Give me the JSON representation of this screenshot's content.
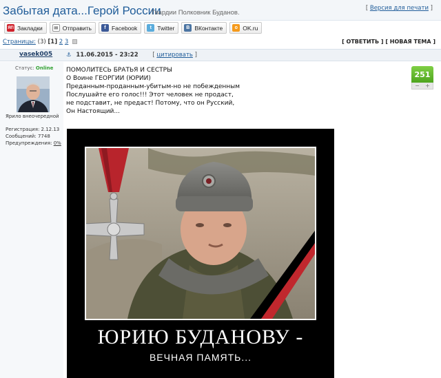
{
  "header": {
    "title": "Забытая дата...Герой России",
    "subtitle": "Гвардии Полковник Буданов.",
    "print_prefix": "[ ",
    "print_link": "Версия для печати",
    "print_suffix": " ]"
  },
  "share": {
    "buttons": [
      {
        "label": "Закладки",
        "icon": "bookmark-icon"
      },
      {
        "label": "Отправить",
        "icon": "envelope-icon"
      },
      {
        "label": "Facebook",
        "icon": "facebook-icon"
      },
      {
        "label": "Twitter",
        "icon": "twitter-icon"
      },
      {
        "label": "ВКонтакте",
        "icon": "vkontakte-icon"
      },
      {
        "label": "OK.ru",
        "icon": "odnoklassniki-icon"
      }
    ]
  },
  "pages": {
    "label": "Страницы:",
    "count": "(3)",
    "current": "[1]",
    "page2": "2",
    "page3": "3"
  },
  "actions": {
    "reply": "[ ОТВЕТИТЬ ]",
    "new_topic": "[ НОВАЯ ТЕМА ]"
  },
  "post": {
    "author": "vasek005",
    "date": "11.06.2015 - 23:22",
    "quote_prefix": "[ ",
    "quote_link": "цитировать",
    "quote_suffix": " ]",
    "lines": [
      "ПОМОЛИТЕСЬ БРАТЬЯ И СЕСТРЫ",
      "О Воине ГЕОРГИИ (ЮРИИ)",
      "Преданным-проданным-убитым-но не побежденным",
      "Послушайте его голос!!! Этот человек не продаст,",
      "не подставит, не предаст! Потому, что он Русский,",
      "Он Настоящий..."
    ],
    "rating": "251",
    "rating_minus": "−",
    "rating_plus": "+"
  },
  "user": {
    "status_label": "Статус:",
    "status_value": "Online",
    "rank": "Ярило внеочередной",
    "reg_label": "Регистрация:",
    "reg_value": "2.12.13",
    "msgs_label": "Сообщений:",
    "msgs_value": "7748",
    "warn_label": "Предупреждения:",
    "warn_value": "0%"
  },
  "image": {
    "title": "ЮРИЮ БУДАНОВУ -",
    "subtitle": "ВЕЧНАЯ ПАМЯТЬ..."
  },
  "colors": {
    "link": "#1f5c99",
    "online": "#33a133",
    "rating_green": "#5cb82a",
    "ribbon_red": "#c0272d"
  }
}
